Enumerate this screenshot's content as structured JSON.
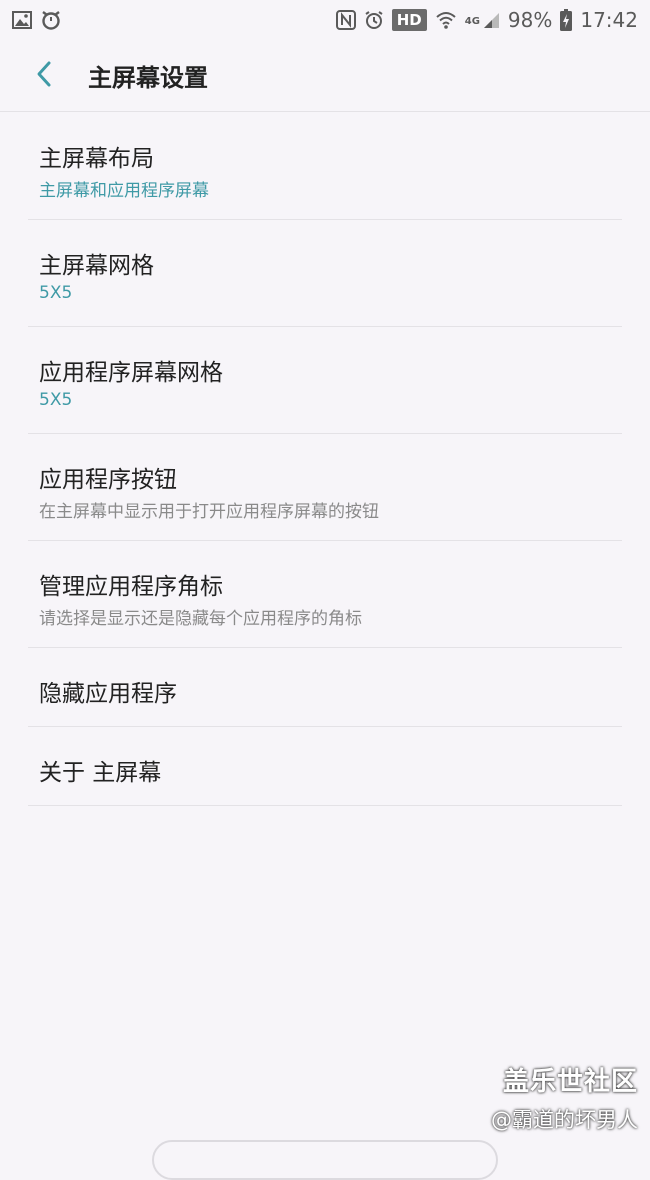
{
  "status_bar": {
    "icons_left": [
      "image-icon",
      "alarm-icon"
    ],
    "nfc": "N",
    "hd": "HD",
    "network": "4G",
    "battery": "98%",
    "time": "17:42"
  },
  "header": {
    "title": "主屏幕设置"
  },
  "settings": {
    "items": [
      {
        "title": "主屏幕布局",
        "subtitle": "主屏幕和应用程序屏幕"
      },
      {
        "title": "主屏幕网格",
        "subtitle": "5X5"
      },
      {
        "title": "应用程序屏幕网格",
        "subtitle": "5X5"
      },
      {
        "title": "应用程序按钮",
        "subtitle": "在主屏幕中显示用于打开应用程序屏幕的按钮"
      },
      {
        "title": "管理应用程序角标",
        "subtitle": "请选择是显示还是隐藏每个应用程序的角标"
      },
      {
        "title": "隐藏应用程序"
      },
      {
        "title": "关于 主屏幕"
      }
    ]
  },
  "watermark": {
    "brand": "盖乐世社区",
    "user": "@霸道的坏男人"
  },
  "colors": {
    "accent": "#3f9aa6",
    "background": "#f7f5f9",
    "divider": "#e4e2e6"
  }
}
